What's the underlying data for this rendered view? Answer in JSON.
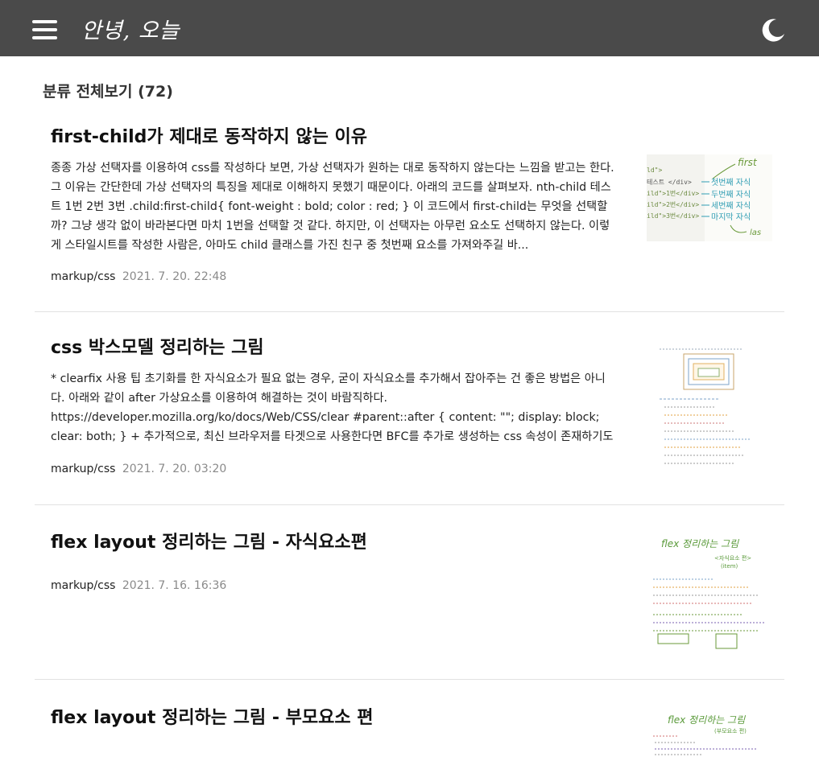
{
  "header": {
    "brand": "안녕, 오늘",
    "menu_icon": "hamburger-menu-icon",
    "theme_icon": "moon-icon"
  },
  "category": {
    "title": "분류 전체보기 (72)"
  },
  "posts": [
    {
      "title": "first-child가 제대로 동작하지 않는 이유",
      "excerpt": "종종 가상 선택자를 이용하여 css를 작성하다 보면, 가상 선택자가 원하는 대로 동작하지 않는다는 느낌을 받고는 한다. 그 이유는 간단한데 가상 선택자의 특징을 제대로 이해하지 못했기 때문이다. 아래의 코드를 살펴보자. nth-child 테스트 1번 2번 3번 .child:first-child{ font-weight : bold; color : red; } 이 코드에서 first-child는 무엇을 선택할까? 그냥 생각 없이 바라본다면 마치 1번을 선택할 것 같다. 하지만, 이 선택자는 아무런 요소도 선택하지 않는다. 이렇게 스타일시트를 작성한 사람은, 아마도 child 클래스를 가진 친구 중 첫번째 요소를 가져와주길 바...",
      "category": "markup/css",
      "date": "2021. 7. 20. 22:48",
      "thumb": {
        "code_lines": [
          "ld\">",
          "테스트 </div>",
          "ild\">1번</div>",
          "ild\">2번</div>",
          "ild\">3번</div>"
        ],
        "notes": [
          "first",
          "첫번째 자식",
          "두번째 자식",
          "세번째 자식",
          "마지막 자식",
          "las"
        ]
      }
    },
    {
      "title": "css 박스모델 정리하는 그림",
      "excerpt": "* clearfix 사용 팁 초기화를 한 자식요소가 필요 없는 경우, 굳이 자식요소를 추가해서 잡아주는 건 좋은 방법은 아니다. 아래와 같이 after 가상요소를 이용하여 해결하는 것이 바람직하다. https://developer.mozilla.org/ko/docs/Web/CSS/clear #parent::after { content: \"\"; display: block; clear: both; } + 추가적으로, 최신 브라우저를 타겟으로 사용한다면 BFC를 추가로 생성하는 css 속성이 존재하기도 한다. .parent{ display : flow-root; }",
      "category": "markup/css",
      "date": "2021. 7. 20. 03:20"
    },
    {
      "title": "flex layout 정리하는 그림 - 자식요소편",
      "excerpt": "",
      "category": "markup/css",
      "date": "2021. 7. 16. 16:36",
      "thumb": {
        "heading": "flex 정리하는 그림",
        "sub": "<자식요소 편>",
        "sub2": "(item)"
      }
    },
    {
      "title": "flex layout 정리하는 그림 - 부모요소 편",
      "excerpt": "",
      "category": "",
      "date": "",
      "thumb": {
        "heading": "flex 정리하는 그림",
        "sub": "(부모요소 편)"
      }
    }
  ]
}
